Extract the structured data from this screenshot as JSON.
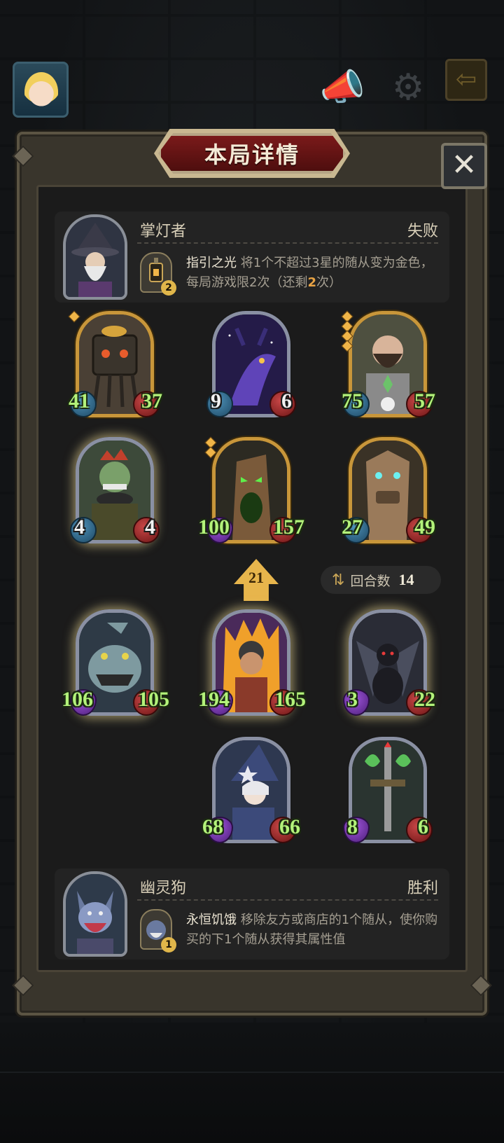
{
  "title": "本局详情",
  "close_label": "✕",
  "top_bar": {
    "sound_icon": "megaphone-icon",
    "settings_icon": "gear-icon",
    "exit_icon": "exit-arrow-icon"
  },
  "player_hero": {
    "name": "掌灯者",
    "result": "失败",
    "skill_level": "2",
    "skill_name": "指引之光",
    "skill_desc_pre": " 将1个不超过3星的随从变为金色，每局游戏限2次（还剩",
    "skill_remaining": "2",
    "skill_desc_post": "次）"
  },
  "player_minions": [
    {
      "atk": "41",
      "hp": "37",
      "stars": 1,
      "frame": "gold"
    },
    {
      "atk": "9",
      "hp": "6",
      "stars": 0,
      "frame": "silver"
    },
    {
      "atk": "75",
      "hp": "57",
      "stars": 4,
      "frame": "gold"
    },
    {
      "atk": "4",
      "hp": "4",
      "stars": 0,
      "frame": "silver"
    },
    {
      "atk": "100",
      "hp": "157",
      "stars": 2,
      "frame": "gold"
    },
    {
      "atk": "27",
      "hp": "49",
      "stars": 0,
      "frame": "gold"
    }
  ],
  "tier": "21",
  "turns": {
    "label": "回合数",
    "value": "14"
  },
  "opponent_minions": [
    {
      "atk": "106",
      "hp": "105"
    },
    {
      "atk": "194",
      "hp": "165"
    },
    {
      "atk": "3",
      "hp": "22"
    },
    {
      "atk": "68",
      "hp": "66"
    },
    {
      "atk": "8",
      "hp": "6"
    }
  ],
  "opponent_hero": {
    "name": "幽灵狗",
    "result": "胜利",
    "skill_level": "1",
    "skill_name": "永恒饥饿",
    "skill_desc": " 移除友方或商店的1个随从，使你购买的下1个随从获得其属性值"
  }
}
